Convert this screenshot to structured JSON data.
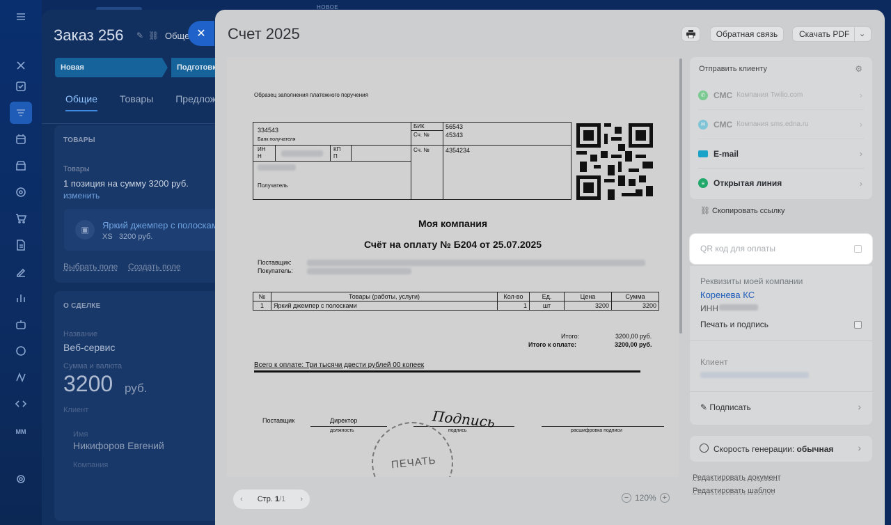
{
  "deal": {
    "title": "Заказ 256",
    "general_label": "Общее",
    "stages": [
      "Новая",
      "Подготовк"
    ],
    "tabs": [
      "Общие",
      "Товары",
      "Предлож"
    ],
    "goods": {
      "section": "ТОВАРЫ",
      "label": "Товары",
      "summary": "1 позиция на сумму 3200 руб.",
      "change_link": "изменить",
      "product_name": "Яркий джемпер с полоскам",
      "product_meta": "XS   3200 руб.",
      "choose_field": "Выбрать поле",
      "create_field": "Создать поле"
    },
    "about": {
      "section": "О СДЕЛКЕ",
      "name_label": "Название",
      "name_value": "Веб-сервис",
      "sum_label": "Сумма и валюта",
      "sum_value": "3200",
      "currency": "руб.",
      "client_label": "Клиент",
      "contact_label": "Имя",
      "contact_value": "Никифоров Евгений",
      "company_label": "Компания"
    }
  },
  "nav": {
    "new_badge": "НОВОЕ",
    "icons": [
      "menu-icon",
      "close-icon",
      "tasks-icon",
      "crm-funnel-icon",
      "calendar-icon",
      "store-icon",
      "target-icon",
      "cart-icon",
      "docs-icon",
      "sign-icon",
      "analytics-icon",
      "robot-icon",
      "marketplace-icon",
      "automation-icon",
      "dev-icon",
      "avatar-icon",
      "settings-icon"
    ]
  },
  "slider": {
    "title": "Счет 2025",
    "print_icon": "printer-icon",
    "feedback": "Обратная связь",
    "download": "Скачать PDF",
    "pager": {
      "label": "Стр.",
      "current": "1",
      "total": "/1"
    },
    "zoom": "120%"
  },
  "document": {
    "header_note": "Образец заполнения платежного поручения",
    "bank_account": "334543",
    "bank_label": "Банк получателя",
    "inn_label": "ИН Н",
    "kpp_label": "КП П",
    "receiver_label": "Получатель",
    "bik_label": "БИК",
    "bik_value": "56543",
    "corr_label": "Сч. №",
    "corr_value": "45343",
    "acc_label": "Сч. №",
    "acc_value": "4354234",
    "company": "Моя компания",
    "invoice_title": "Счёт на оплату № Б204 от 25.07.2025",
    "supplier_label": "Поставщик:",
    "buyer_label": "Покупатель:",
    "table_headers": [
      "№",
      "Товары (работы, услуги)",
      "Кол-во",
      "Ед.",
      "Цена",
      "Сумма"
    ],
    "table_rows": [
      [
        "1",
        "Яркий джемпер с полосками",
        "1",
        "шт",
        "3200",
        "3200"
      ]
    ],
    "total_label": "Итого:",
    "total_value": "3200,00 руб.",
    "to_pay_label": "Итого к оплате:",
    "to_pay_value": "3200,00 руб.",
    "words": "Всего к оплате: Три тысячи двести рублей 00 копеек",
    "sign_supplier": "Поставщик",
    "sign_position": "Директор",
    "sign_position_caption": "должность",
    "signature": "Подпись",
    "sign_caption": "подпись",
    "decode_caption": "расшифровка подписи",
    "stamp": "ПЕЧАТЬ"
  },
  "side": {
    "send_title": "Отправить клиенту",
    "channels": [
      {
        "name": "СМС",
        "provider": "Компания Twilio.com",
        "icon": "whatsapp-icon",
        "color": "#2fbf56",
        "disabled": true
      },
      {
        "name": "СМС",
        "provider": "Компания sms.edna.ru",
        "icon": "chat-icon",
        "color": "#3ab7d6",
        "disabled": true
      },
      {
        "name": "E-mail",
        "provider": "",
        "icon": "mail-icon",
        "color": "#1aa3c8",
        "disabled": false
      },
      {
        "name": "Открытая линия",
        "provider": "",
        "icon": "openline-icon",
        "color": "#1fa86a",
        "disabled": false
      }
    ],
    "copy_link": "Скопировать ссылку",
    "qr_label": "QR код для оплаты",
    "req_label": "Реквизиты моей компании",
    "company_name": "Коренева КС",
    "inn_label": "ИНН",
    "stamp_sign": "Печать и подпись",
    "client_label": "Клиент",
    "sign_label": "Подписать",
    "speed_label": "Скорость генерации:",
    "speed_value": "обычная",
    "edit_doc": "Редактировать документ",
    "edit_tpl": "Редактировать шаблон"
  },
  "colors": {
    "accent": "#1f62c9",
    "link": "#1d5bb8",
    "overlay": "#0c2a5e"
  }
}
